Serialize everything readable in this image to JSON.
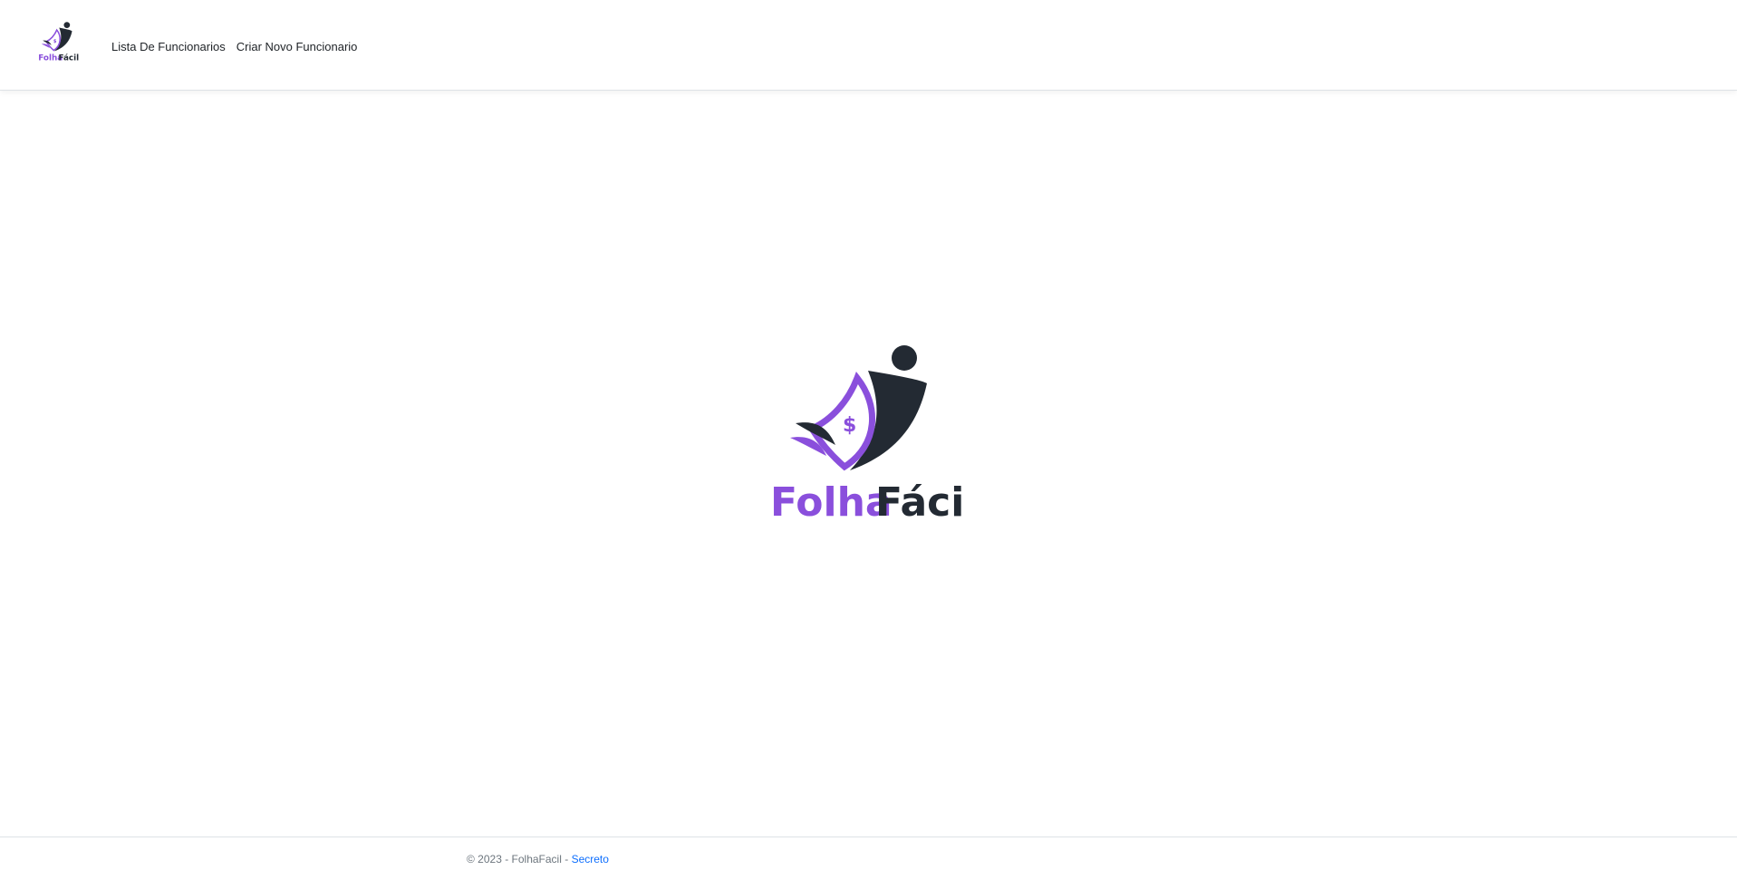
{
  "brand": {
    "name_part1": "Folha",
    "name_part2": "Fácil",
    "logo_icon": "folhafacil-logo-icon",
    "colors": {
      "purple": "#8a4fdc",
      "dark": "#232a33"
    }
  },
  "nav": {
    "items": [
      {
        "label": "Lista De Funcionarios"
      },
      {
        "label": "Criar Novo Funcionario"
      }
    ]
  },
  "footer": {
    "copyright": "© 2023 - FolhaFacil - ",
    "link_label": "Secreto",
    "link_color": "#0d6efd"
  }
}
